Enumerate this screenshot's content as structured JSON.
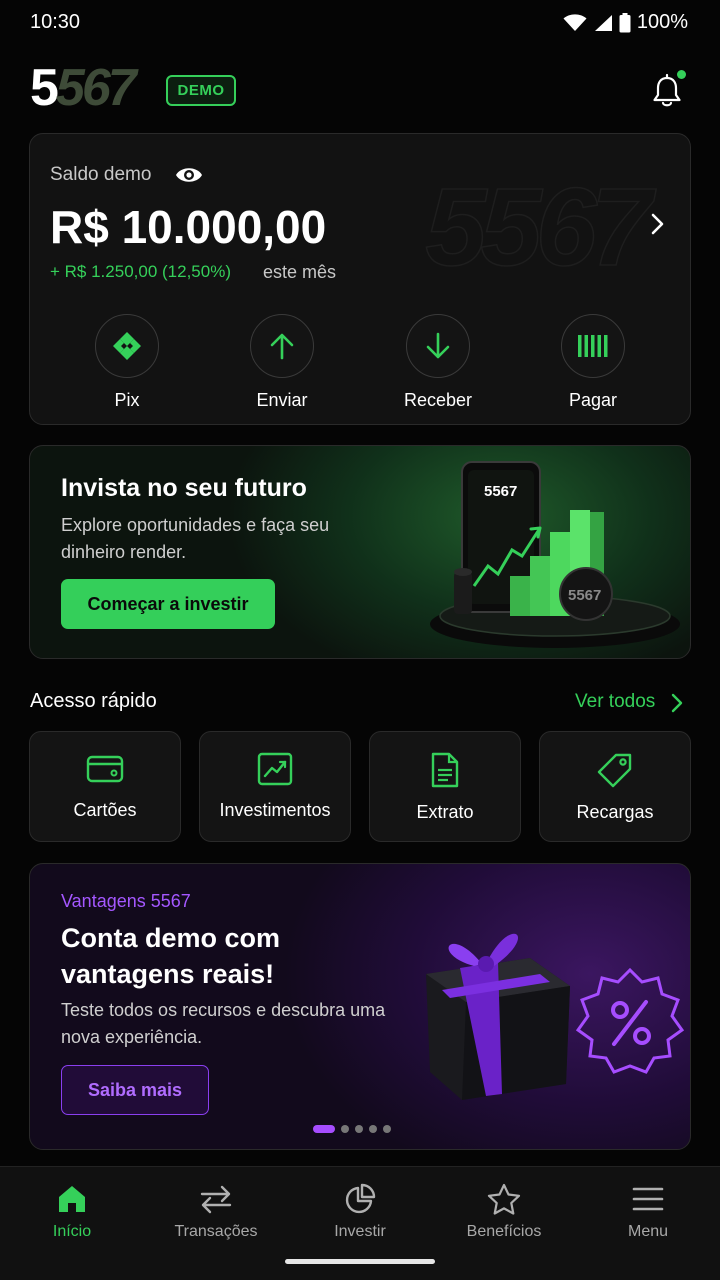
{
  "status": {
    "time": "10:30",
    "battery": "100%"
  },
  "header": {
    "logo_a": "5",
    "logo_b": "567",
    "badge": "DEMO",
    "bell_icon": "bell-icon"
  },
  "balance": {
    "label": "Saldo demo",
    "value": "R$ 10.000,00",
    "gain": "+ R$ 1.250,00 (12,50%)",
    "gain_suffix": "este mês",
    "watermark": "5567",
    "actions": [
      {
        "label": "Pix",
        "icon": "pix-icon"
      },
      {
        "label": "Enviar",
        "icon": "arrow-up-icon"
      },
      {
        "label": "Receber",
        "icon": "arrow-down-icon"
      },
      {
        "label": "Pagar",
        "icon": "barcode-icon"
      }
    ]
  },
  "invest": {
    "title": "Invista no seu futuro",
    "text": "Explore oportunidades e faça seu dinheiro render.",
    "button": "Começar a investir",
    "phone_logo": "5567",
    "coin_logo": "5567"
  },
  "quick_access": {
    "title": "Acesso rápido",
    "see_all": "Ver todos",
    "items": [
      {
        "label": "Cartões",
        "icon": "card-icon"
      },
      {
        "label": "Investimentos",
        "icon": "chart-icon"
      },
      {
        "label": "Extrato",
        "icon": "document-icon"
      },
      {
        "label": "Recargas",
        "icon": "tag-icon"
      }
    ]
  },
  "promo": {
    "tag": "Vantagens 5567",
    "title": "Conta demo com vantagens reais!",
    "text": "Teste todos os recursos e descubra uma nova experiência.",
    "button": "Saiba mais",
    "slide_count": 5,
    "active_slide": 1
  },
  "nav": {
    "items": [
      {
        "label": "Início",
        "icon": "home-icon",
        "active": true
      },
      {
        "label": "Transações",
        "icon": "transfer-icon",
        "active": false
      },
      {
        "label": "Investir",
        "icon": "pie-chart-icon",
        "active": false
      },
      {
        "label": "Benefícios",
        "icon": "star-icon",
        "active": false
      },
      {
        "label": "Menu",
        "icon": "menu-icon",
        "active": false
      }
    ]
  },
  "colors": {
    "accent": "#35d05a",
    "purple": "#a64dff",
    "background": "#050505"
  }
}
